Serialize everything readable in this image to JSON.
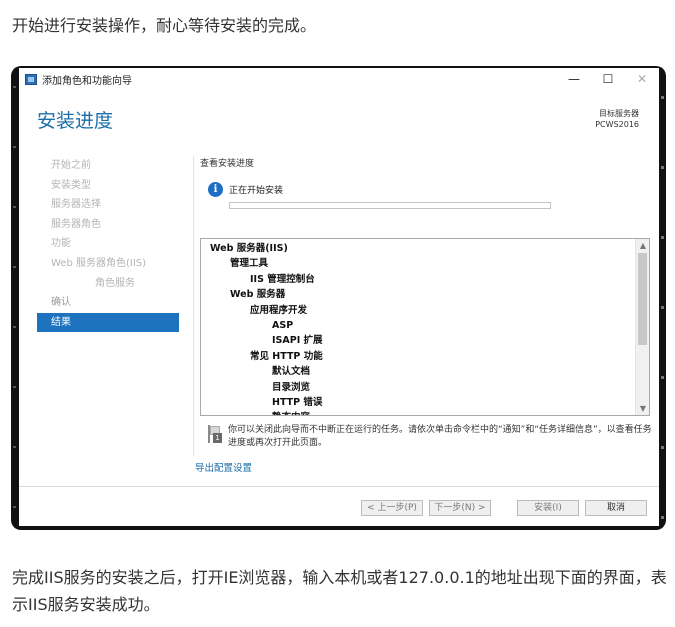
{
  "article": {
    "para_top": "开始进行安装操作，耐心等待安装的完成。",
    "para_bottom": "完成IIS服务的安装之后，打开IE浏览器，输入本机或者127.0.0.1的地址出现下面的界面，表示IIS服务安装成功。"
  },
  "window": {
    "title": "添加角色和功能向导",
    "controls": {
      "minimize": "—",
      "maximize": "☐",
      "close": "✕"
    }
  },
  "header": {
    "page_title": "安装进度",
    "target_label": "目标服务器",
    "target_server": "PCWS2016"
  },
  "nav": {
    "items": [
      {
        "label": "开始之前",
        "state": "disabled"
      },
      {
        "label": "安装类型",
        "state": "disabled"
      },
      {
        "label": "服务器选择",
        "state": "disabled"
      },
      {
        "label": "服务器角色",
        "state": "disabled"
      },
      {
        "label": "功能",
        "state": "disabled"
      },
      {
        "label": "Web 服务器角色(IIS)",
        "state": "disabled"
      },
      {
        "label": "角色服务",
        "state": "disabled"
      },
      {
        "label": "确认",
        "state": "done"
      },
      {
        "label": "结果",
        "state": "active"
      }
    ]
  },
  "progress": {
    "section_title": "查看安装进度",
    "status": "正在开始安装",
    "fraction": 0.0,
    "accent": "#06b025"
  },
  "features": [
    {
      "label": "Web 服务器(IIS)",
      "level": 0
    },
    {
      "label": "管理工具",
      "level": 1
    },
    {
      "label": "IIS 管理控制台",
      "level": 2
    },
    {
      "label": "Web 服务器",
      "level": 1
    },
    {
      "label": "应用程序开发",
      "level": 2
    },
    {
      "label": "ASP",
      "level": 3
    },
    {
      "label": "ISAPI 扩展",
      "level": 3
    },
    {
      "label": "常见 HTTP 功能",
      "level": 2
    },
    {
      "label": "默认文档",
      "level": 3
    },
    {
      "label": "目录浏览",
      "level": 3
    },
    {
      "label": "HTTP 错误",
      "level": 3
    },
    {
      "label": "静态内容",
      "level": 3
    }
  ],
  "note": "你可以关闭此向导而不中断正在运行的任务。请依次单击命令栏中的“通知”和“任务详细信息”，以查看任务进度或再次打开此页面。",
  "note_badge": "1",
  "export_link": "导出配置设置",
  "buttons": {
    "prev": "< 上一步(P)",
    "next": "下一步(N) >",
    "install": "安装(I)",
    "cancel": "取消"
  },
  "colors": {
    "title_blue": "#1b6ea8",
    "nav_active": "#1e73be",
    "info_icon": "#1e6fc4"
  }
}
